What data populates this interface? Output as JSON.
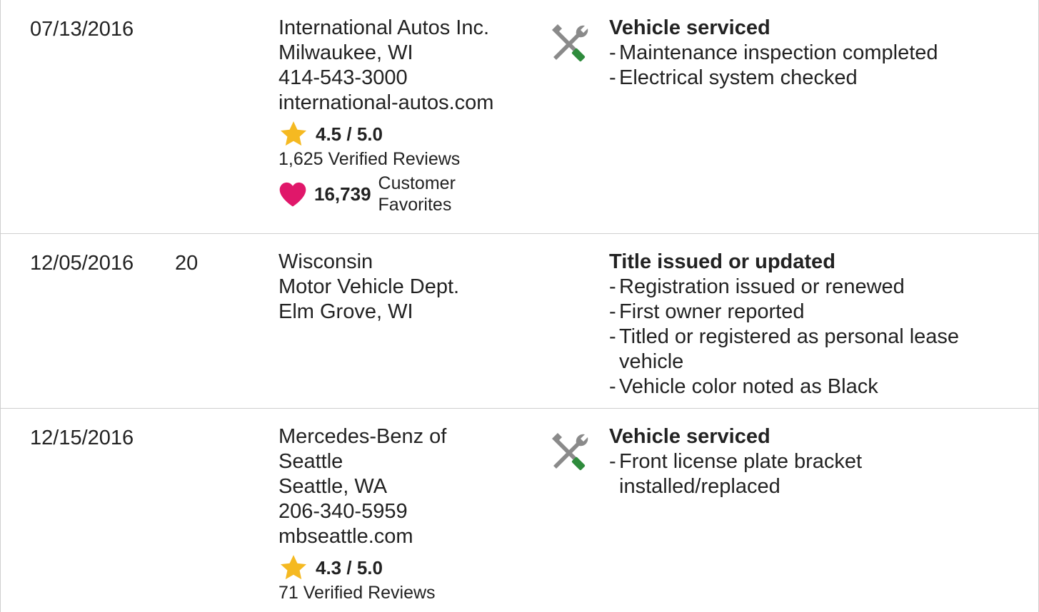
{
  "records": [
    {
      "date": "07/13/2016",
      "mileage": "",
      "source_lines": [
        "International Autos Inc.",
        "Milwaukee, WI",
        "414-543-3000",
        "international-autos.com"
      ],
      "rating": "4.5 / 5.0",
      "reviews": "1,625 Verified Reviews",
      "favorites_count": "16,739",
      "favorites_label": [
        "Customer",
        "Favorites"
      ],
      "icon": "wrench-screwdriver-icon",
      "heading": "Vehicle serviced",
      "items": [
        "Maintenance inspection completed",
        "Electrical system checked"
      ]
    },
    {
      "date": "12/05/2016",
      "mileage": "20",
      "source_lines": [
        "Wisconsin",
        "Motor Vehicle Dept.",
        "Elm Grove, WI"
      ],
      "heading": "Title issued or updated",
      "items": [
        "Registration issued or renewed",
        "First owner reported",
        "Titled or registered as personal lease vehicle",
        "Vehicle color noted as Black"
      ]
    },
    {
      "date": "12/15/2016",
      "mileage": "",
      "source_lines": [
        "Mercedes-Benz of",
        "Seattle",
        "Seattle, WA",
        "206-340-5959",
        "mbseattle.com"
      ],
      "rating": "4.3 / 5.0",
      "reviews": "71 Verified Reviews",
      "icon": "wrench-screwdriver-icon",
      "heading": "Vehicle serviced",
      "items": [
        "Front license plate bracket",
        "installed/replaced"
      ]
    }
  ],
  "colors": {
    "star": "#f5b921",
    "heart": "#e0176a",
    "tool_gray": "#8a8a8a",
    "tool_green": "#2e8b3c",
    "border": "#cfcfcf"
  }
}
